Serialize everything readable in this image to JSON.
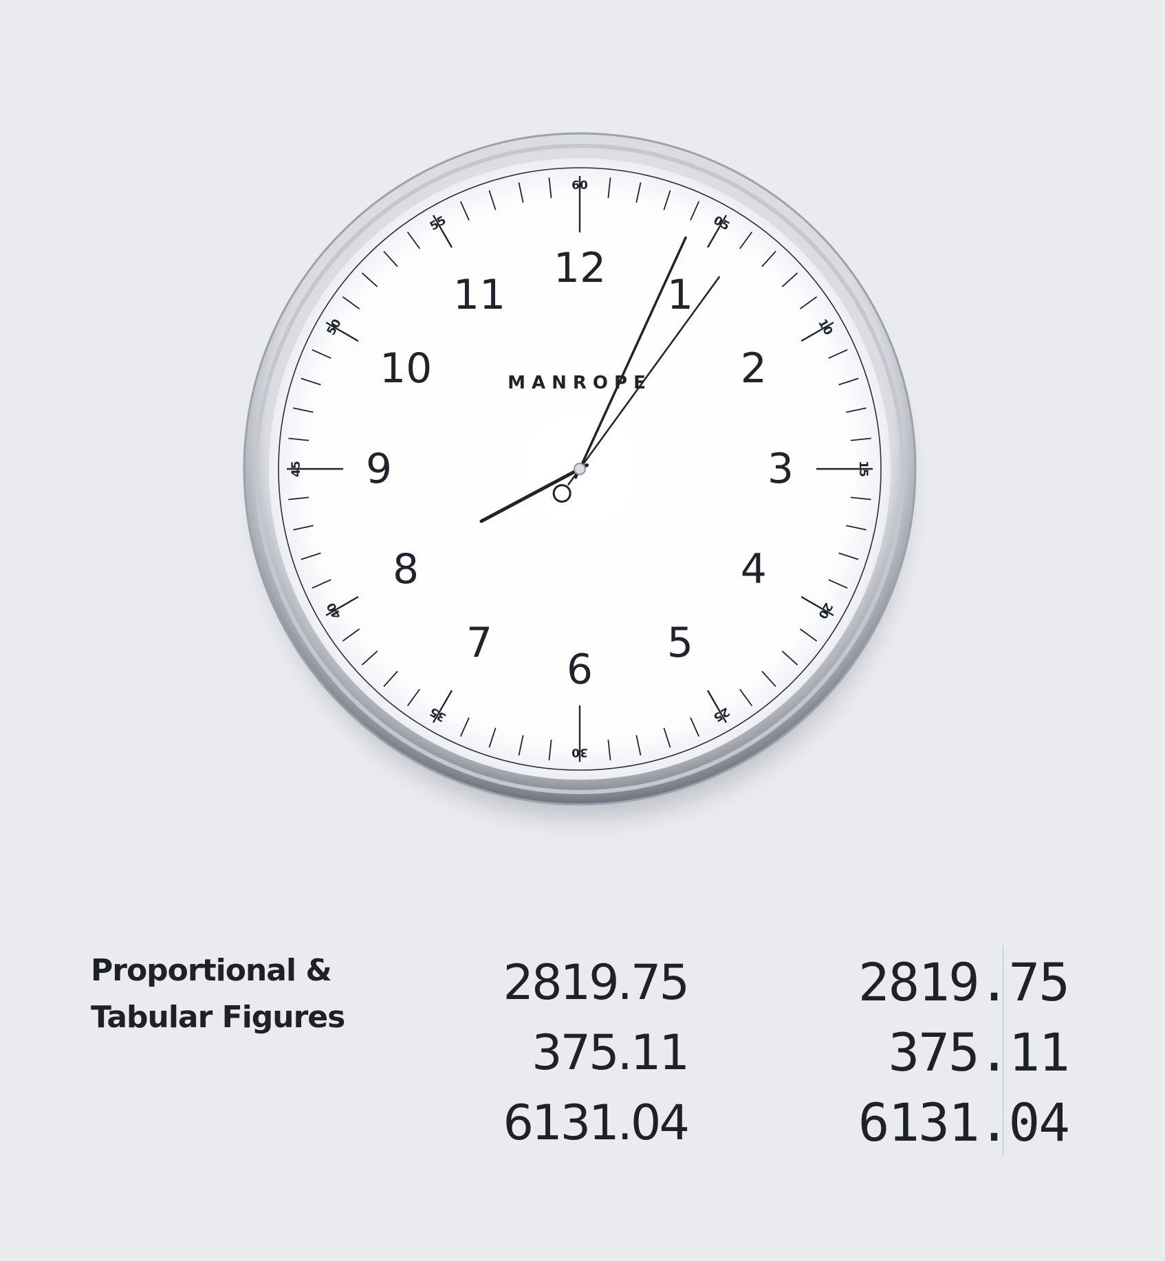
{
  "clock": {
    "brand": "MANROPE",
    "hour_numerals": [
      "12",
      "1",
      "2",
      "3",
      "4",
      "5",
      "6",
      "7",
      "8",
      "9",
      "10",
      "11"
    ],
    "minute_labels": [
      "60",
      "05",
      "10",
      "15",
      "20",
      "25",
      "30",
      "35",
      "40",
      "45",
      "50",
      "55"
    ],
    "time_shown": {
      "hour": 8,
      "minute": 4,
      "second": 6
    },
    "colors": {
      "background": "#eaebef",
      "face": "#ffffff",
      "ink": "#1f232b",
      "rim": "#b9bcc3"
    }
  },
  "figures": {
    "caption_lines": [
      "Proportional &",
      "Tabular Figures"
    ],
    "proportional": [
      "2819.75",
      "375.11",
      "6131.04"
    ],
    "tabular": [
      "2819.75",
      "375.11",
      "6131.04"
    ],
    "guide_color": "#9ed49a"
  }
}
